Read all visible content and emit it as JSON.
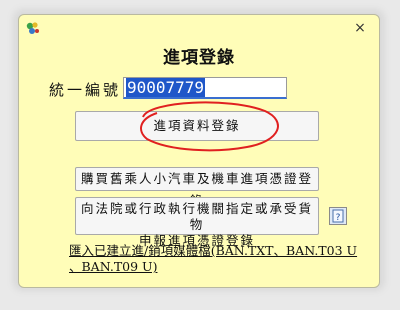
{
  "window": {
    "icon": "app-leaf-icon",
    "close_label": "×"
  },
  "dialog": {
    "title": "進項登錄"
  },
  "tax_id": {
    "label": "統一編號",
    "value": "90007779"
  },
  "buttons": {
    "main": "進項資料登錄",
    "buy_vehicle": "購買舊乘人小汽車及機車進項憑證登錄",
    "court_line1": "向法院或行政執行機關指定或承受貨物",
    "court_line2": "申報進項憑證登錄"
  },
  "import_link": {
    "line1": "匯入已建立進/銷項媒體檔(BAN.TXT、BAN.T03 U",
    "line2": "、BAN.T09 U)"
  },
  "colors": {
    "window_bg": "#fffdb8",
    "selection": "#1f57c9",
    "annotation": "#e02020"
  }
}
